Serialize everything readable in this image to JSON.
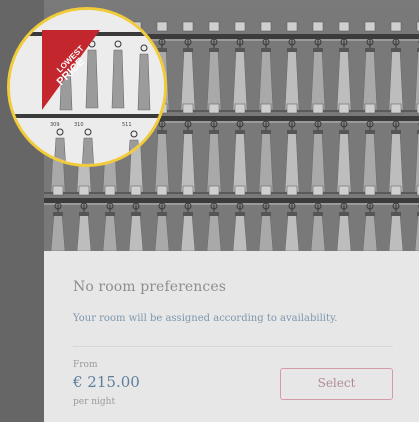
{
  "room": {
    "preference_title": "No room preferences",
    "preference_note": "Your room will be assigned according to availability.",
    "from_label": "From",
    "price": "€ 215.00",
    "per_night": "per night",
    "select_label": "Select"
  },
  "badge": {
    "line1": "LOWEST",
    "line2": "PRICE",
    "color": "#c4262d"
  },
  "photo": {
    "room_tag_1": "309",
    "room_tag_2": "310",
    "room_tag_3": "511"
  },
  "colors": {
    "accent_blue": "#5d7e9c",
    "button_border": "#d59aa6",
    "highlight_ring": "#f2cb3a"
  }
}
